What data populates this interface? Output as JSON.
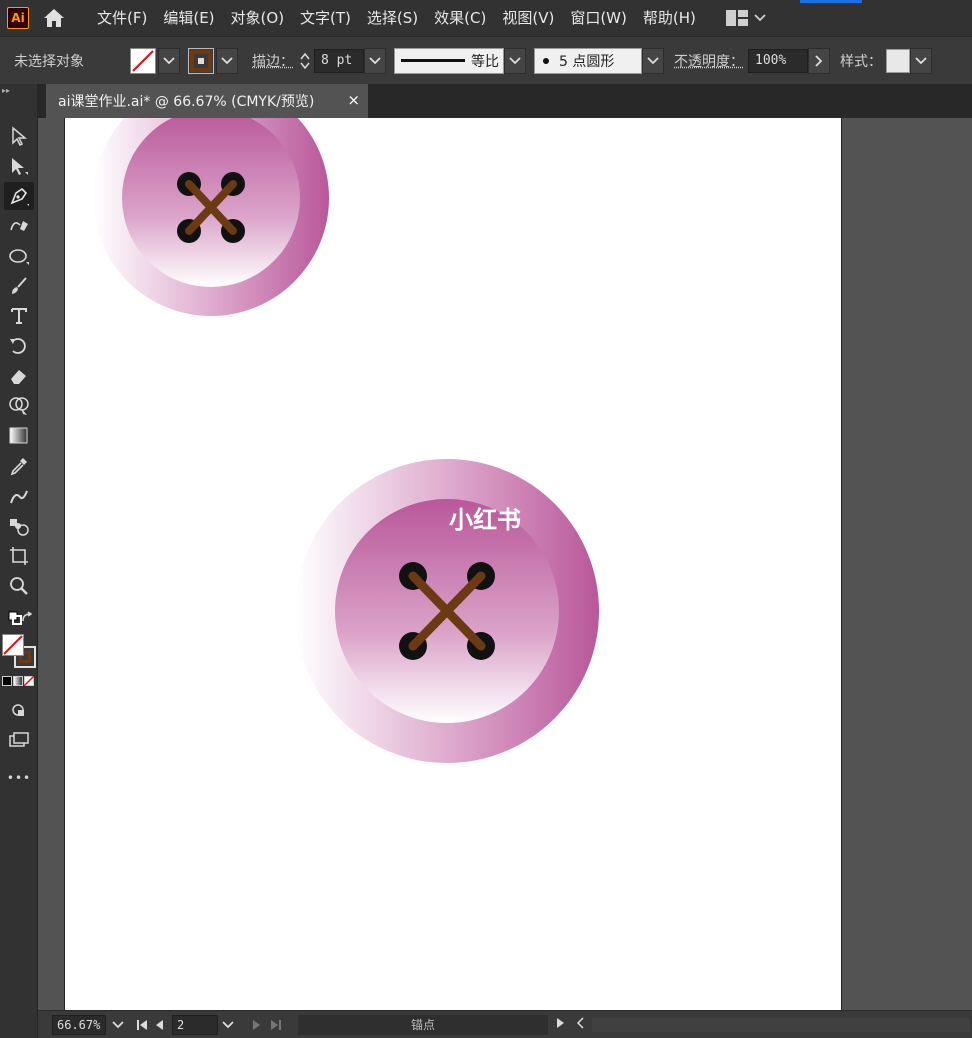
{
  "app": {
    "logo_text": "Ai"
  },
  "menu": {
    "items": [
      {
        "label": "文件(F)"
      },
      {
        "label": "编辑(E)"
      },
      {
        "label": "对象(O)"
      },
      {
        "label": "文字(T)"
      },
      {
        "label": "选择(S)"
      },
      {
        "label": "效果(C)"
      },
      {
        "label": "视图(V)"
      },
      {
        "label": "窗口(W)"
      },
      {
        "label": "帮助(H)"
      }
    ]
  },
  "control_bar": {
    "selection_status": "未选择对象",
    "stroke_label": "描边：",
    "stroke_weight": "8 pt",
    "profile_label": "等比",
    "brush_label": "5 点圆形",
    "opacity_label": "不透明度：",
    "opacity_value": "100%",
    "style_label": "样式：",
    "stroke_color": "#6b3a12",
    "fill": "none"
  },
  "document_tab": {
    "title": "ai课堂作业.ai* @ 66.67% (CMYK/预览)",
    "close_symbol": "×"
  },
  "canvas": {
    "watermark_text": "小红书",
    "button_colors": {
      "outer_right": "#b9579a",
      "outer_left": "#ffffff",
      "inner_top": "#b9579a",
      "inner_bottom": "#ffffff",
      "thread": "#6b3a12",
      "holes": "#111111"
    }
  },
  "status_bar": {
    "zoom": "66.67%",
    "artboard_number": "2",
    "tool_status": "锚点"
  },
  "toolbar": {
    "more_symbol": "•••"
  }
}
